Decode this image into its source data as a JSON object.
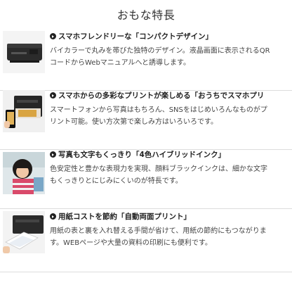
{
  "page": {
    "title": "おもな特長"
  },
  "features": [
    {
      "image": "printer-with-paper-tray",
      "heading": "スマホフレンドリーな「コンパクトデザイン」",
      "lines": [
        "バイカラーで丸みを帯びた独特のデザイン。液晶画面に表示されるQR",
        "コードからWebマニュアルへと誘導します。"
      ]
    },
    {
      "image": "printer-with-smartphone-photo",
      "heading": "スマホからの多彩なプリントが楽しめる「おうちでスマホプリ",
      "lines": [
        "スマートフォンから写真はもちろん、SNSをはじめいろんなものがプ",
        "リント可能。使い方次第で楽しみ方はいろいろです。"
      ]
    },
    {
      "image": "child-photo-print",
      "heading": "写真も文字もくっきり「4色ハイブリッドインク」",
      "lines": [
        "色安定性と豊かな表現力を実現、顔料ブラックインクは、細かな文字",
        "もくっきりとにじみにくいのが特長です。"
      ]
    },
    {
      "image": "printer-duplex-output",
      "heading": "用紙コストを節約「自動両面プリント」",
      "lines": [
        "用紙の表と裏を入れ替える手間が省けて、用紙の節約にもつながりま",
        "す。WEBページや大量の資料の印刷にも便利です。"
      ]
    }
  ],
  "colors": {
    "text": "#333333",
    "divider": "#dddddd",
    "printer_body": "#2b2b2b"
  }
}
